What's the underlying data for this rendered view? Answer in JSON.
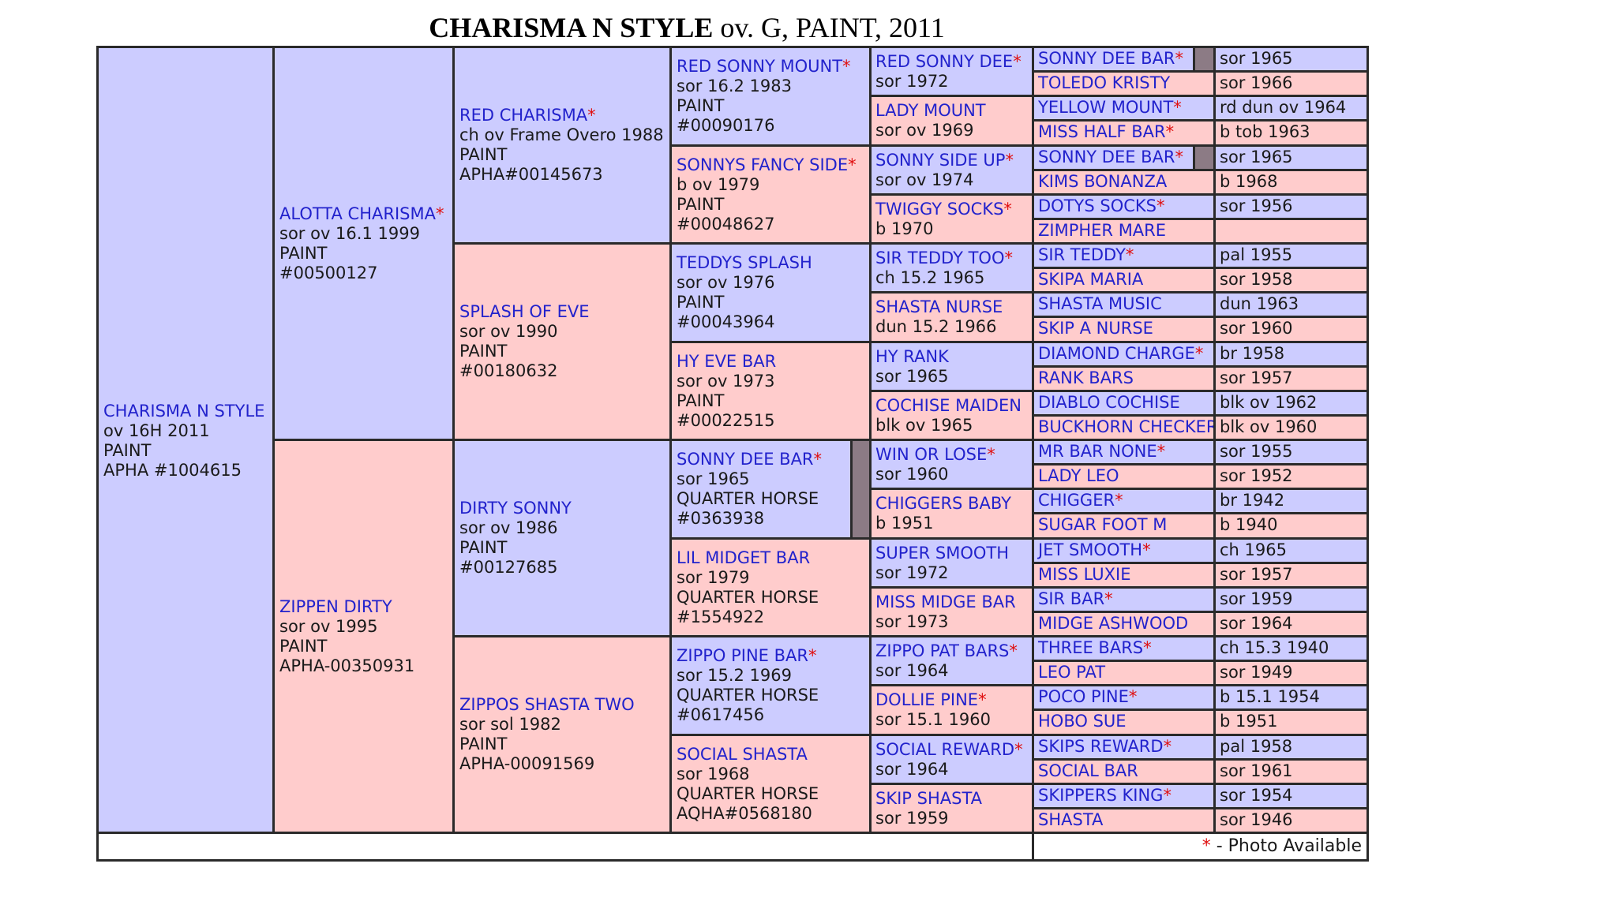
{
  "title": {
    "name": "CHARISMA N STYLE",
    "rest": " ov. G, PAINT, 2011"
  },
  "legend": {
    "star": "*",
    "text": " - Photo Available"
  },
  "gen1": {
    "name": "CHARISMA N STYLE",
    "l1": "ov 16H 2011",
    "l2": "PAINT",
    "l3": "APHA #1004615"
  },
  "gen2": [
    {
      "name": "ALOTTA CHARISMA",
      "star": "*",
      "l1": "sor ov 16.1 1999",
      "l2": "PAINT",
      "l3": "#00500127"
    },
    {
      "name": "ZIPPEN DIRTY",
      "star": "",
      "l1": "sor ov 1995",
      "l2": "PAINT",
      "l3": "APHA-00350931"
    }
  ],
  "gen3": [
    {
      "name": "RED CHARISMA",
      "star": "*",
      "l1": "ch ov Frame Overo 1988",
      "l2": "PAINT",
      "l3": "APHA#00145673"
    },
    {
      "name": "SPLASH OF EVE",
      "star": "",
      "l1": "sor ov 1990",
      "l2": "PAINT",
      "l3": "#00180632"
    },
    {
      "name": "DIRTY SONNY",
      "star": "",
      "l1": "sor ov 1986",
      "l2": "PAINT",
      "l3": "#00127685"
    },
    {
      "name": "ZIPPOS SHASTA TWO",
      "star": "",
      "l1": "sor sol 1982",
      "l2": "PAINT",
      "l3": "APHA-00091569"
    }
  ],
  "gen4": [
    {
      "name": "RED SONNY MOUNT",
      "star": "*",
      "l1": "sor 16.2 1983",
      "l2": "PAINT",
      "l3": "#00090176"
    },
    {
      "name": "SONNYS FANCY SIDE",
      "star": "*",
      "l1": "b ov 1979",
      "l2": "PAINT",
      "l3": "#00048627"
    },
    {
      "name": "TEDDYS SPLASH",
      "star": "",
      "l1": "sor ov 1976",
      "l2": "PAINT",
      "l3": "#00043964"
    },
    {
      "name": "HY EVE BAR",
      "star": "",
      "l1": "sor ov 1973",
      "l2": "PAINT",
      "l3": "#00022515"
    },
    {
      "name": "SONNY DEE BAR",
      "star": "*",
      "l1": "sor 1965",
      "l2": "QUARTER HORSE",
      "l3": "#0363938"
    },
    {
      "name": "LIL MIDGET BAR",
      "star": "",
      "l1": "sor 1979",
      "l2": "QUARTER HORSE",
      "l3": "#1554922"
    },
    {
      "name": "ZIPPO PINE BAR",
      "star": "*",
      "l1": "sor 15.2 1969",
      "l2": "QUARTER HORSE",
      "l3": "#0617456"
    },
    {
      "name": "SOCIAL SHASTA",
      "star": "",
      "l1": "sor 1968",
      "l2": "QUARTER HORSE",
      "l3": "AQHA#0568180"
    }
  ],
  "gen5": [
    {
      "name": "RED SONNY DEE",
      "star": "*",
      "l1": "sor 1972"
    },
    {
      "name": "LADY MOUNT",
      "star": "",
      "l1": "sor ov 1969"
    },
    {
      "name": "SONNY SIDE UP",
      "star": "*",
      "l1": "sor ov 1974"
    },
    {
      "name": "TWIGGY SOCKS",
      "star": "*",
      "l1": "b 1970"
    },
    {
      "name": "SIR TEDDY TOO",
      "star": "*",
      "l1": "ch 15.2 1965"
    },
    {
      "name": "SHASTA NURSE",
      "star": "",
      "l1": "dun 15.2 1966"
    },
    {
      "name": "HY RANK",
      "star": "",
      "l1": "sor 1965"
    },
    {
      "name": "COCHISE MAIDEN",
      "star": "",
      "l1": "blk ov 1965"
    },
    {
      "name": "WIN OR LOSE",
      "star": "*",
      "l1": "sor 1960"
    },
    {
      "name": "CHIGGERS BABY",
      "star": "",
      "l1": "b 1951"
    },
    {
      "name": "SUPER SMOOTH",
      "star": "",
      "l1": "sor 1972"
    },
    {
      "name": "MISS MIDGE BAR",
      "star": "",
      "l1": "sor 1973"
    },
    {
      "name": "ZIPPO PAT BARS",
      "star": "*",
      "l1": "sor 1964"
    },
    {
      "name": "DOLLIE PINE",
      "star": "*",
      "l1": "sor 15.1 1960"
    },
    {
      "name": "SOCIAL REWARD",
      "star": "*",
      "l1": "sor 1964"
    },
    {
      "name": "SKIP SHASTA",
      "star": "",
      "l1": "sor 1959"
    }
  ],
  "gen6": [
    {
      "name": "SONNY DEE BAR",
      "star": "*",
      "info": "sor 1965"
    },
    {
      "name": "TOLEDO KRISTY",
      "star": "",
      "info": "sor 1966"
    },
    {
      "name": "YELLOW MOUNT",
      "star": "*",
      "info": "rd dun ov 1964"
    },
    {
      "name": "MISS HALF BAR",
      "star": "*",
      "info": "b tob 1963"
    },
    {
      "name": "SONNY DEE BAR",
      "star": "*",
      "info": "sor 1965"
    },
    {
      "name": "KIMS BONANZA",
      "star": "",
      "info": "b 1968"
    },
    {
      "name": "DOTYS SOCKS",
      "star": "*",
      "info": "sor 1956"
    },
    {
      "name": "ZIMPHER MARE",
      "star": "",
      "info": ""
    },
    {
      "name": "SIR TEDDY",
      "star": "*",
      "info": "pal 1955"
    },
    {
      "name": "SKIPA MARIA",
      "star": "",
      "info": "sor 1958"
    },
    {
      "name": "SHASTA MUSIC",
      "star": "",
      "info": "dun 1963"
    },
    {
      "name": "SKIP A NURSE",
      "star": "",
      "info": "sor 1960"
    },
    {
      "name": "DIAMOND CHARGE",
      "star": "*",
      "info": "br 1958"
    },
    {
      "name": "RANK BARS",
      "star": "",
      "info": "sor 1957"
    },
    {
      "name": "DIABLO COCHISE",
      "star": "",
      "info": "blk ov 1962"
    },
    {
      "name": "BUCKHORN CHECKERS",
      "star": "",
      "info": "blk ov 1960"
    },
    {
      "name": "MR BAR NONE",
      "star": "*",
      "info": "sor 1955"
    },
    {
      "name": "LADY LEO",
      "star": "",
      "info": "sor 1952"
    },
    {
      "name": "CHIGGER",
      "star": "*",
      "info": "br 1942"
    },
    {
      "name": "SUGAR FOOT M",
      "star": "",
      "info": "b 1940"
    },
    {
      "name": "JET SMOOTH",
      "star": "*",
      "info": "ch 1965"
    },
    {
      "name": "MISS LUXIE",
      "star": "",
      "info": "sor 1957"
    },
    {
      "name": "SIR BAR",
      "star": "*",
      "info": "sor 1959"
    },
    {
      "name": "MIDGE ASHWOOD",
      "star": "",
      "info": "sor 1964"
    },
    {
      "name": "THREE BARS",
      "star": "*",
      "info": "ch 15.3 1940"
    },
    {
      "name": "LEO PAT",
      "star": "",
      "info": "sor 1949"
    },
    {
      "name": "POCO PINE",
      "star": "*",
      "info": "b 15.1 1954"
    },
    {
      "name": "HOBO SUE",
      "star": "",
      "info": "b 1951"
    },
    {
      "name": "SKIPS REWARD",
      "star": "*",
      "info": "pal 1958"
    },
    {
      "name": "SOCIAL BAR",
      "star": "",
      "info": "sor 1961"
    },
    {
      "name": "SKIPPERS KING",
      "star": "*",
      "info": "sor 1954"
    },
    {
      "name": "SHASTA",
      "star": "",
      "info": "sor 1946"
    }
  ],
  "colors": {
    "sire": "#ccccff",
    "dam": "#ffcccc",
    "name": "#2222cc",
    "star": "#e01010",
    "border": "#2a2a2a"
  }
}
